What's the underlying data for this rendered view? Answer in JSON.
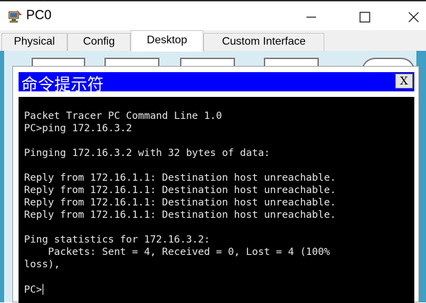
{
  "window": {
    "title": "PC0",
    "icon": "packet-tracer-pc-icon",
    "controls": {
      "minimize": "minimize-icon",
      "maximize": "maximize-icon",
      "close": "close-icon"
    }
  },
  "tabs": [
    {
      "label": "Physical"
    },
    {
      "label": "Config"
    },
    {
      "label": "Desktop",
      "active": true
    },
    {
      "label": "Custom Interface"
    }
  ],
  "command_prompt": {
    "title": "命令提示符",
    "close_label": "X",
    "lines": [
      "Packet Tracer PC Command Line 1.0",
      "PC>ping 172.16.3.2",
      "",
      "Pinging 172.16.3.2 with 32 bytes of data:",
      "",
      "Reply from 172.16.1.1: Destination host unreachable.",
      "Reply from 172.16.1.1: Destination host unreachable.",
      "Reply from 172.16.1.1: Destination host unreachable.",
      "Reply from 172.16.1.1: Destination host unreachable.",
      "",
      "Ping statistics for 172.16.3.2:",
      "    Packets: Sent = 4, Received = 0, Lost = 4 (100%",
      "loss),",
      "",
      "PC>"
    ]
  },
  "colors": {
    "desktop_background": "#3f9fc4",
    "cmd_titlebar": "#0000ff",
    "console_background": "#000000",
    "console_text": "#e8e8e8"
  }
}
